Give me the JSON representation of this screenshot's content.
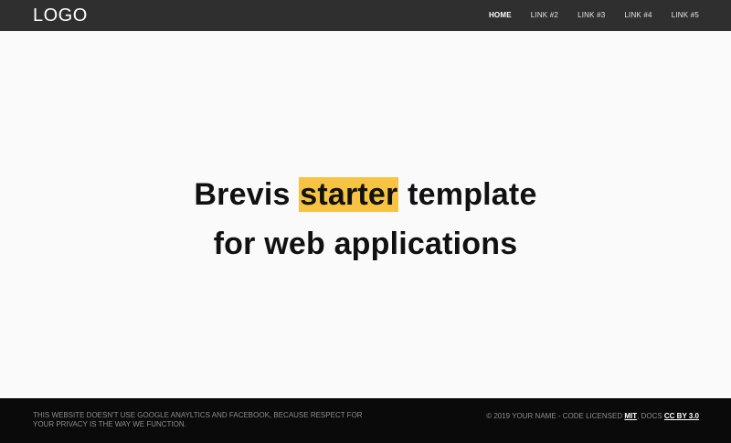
{
  "header": {
    "logo": "LOGO",
    "nav": [
      {
        "label": "HOME",
        "active": true
      },
      {
        "label": "LINK #2",
        "active": false
      },
      {
        "label": "LINK #3",
        "active": false
      },
      {
        "label": "LINK #4",
        "active": false
      },
      {
        "label": "LINK #5",
        "active": false
      }
    ]
  },
  "hero": {
    "line1_before": "Brevis ",
    "line1_highlight": "starter",
    "line1_after": " template",
    "line2": "for web applications"
  },
  "footer": {
    "left_text": "This website doesn't use Google Anayltics and Facebook, because respect for your privacy is the way we function.",
    "right_prefix": "© 2019 Your Name - Code licensed ",
    "mit_link": "MIT",
    "right_middle": ", docs ",
    "cc_link": "CC BY 3.0"
  },
  "colors": {
    "header_bg": "#2f2f2f",
    "footer_bg": "#0a0a0a",
    "highlight": "#f6c342",
    "page_bg": "#fafafa"
  }
}
